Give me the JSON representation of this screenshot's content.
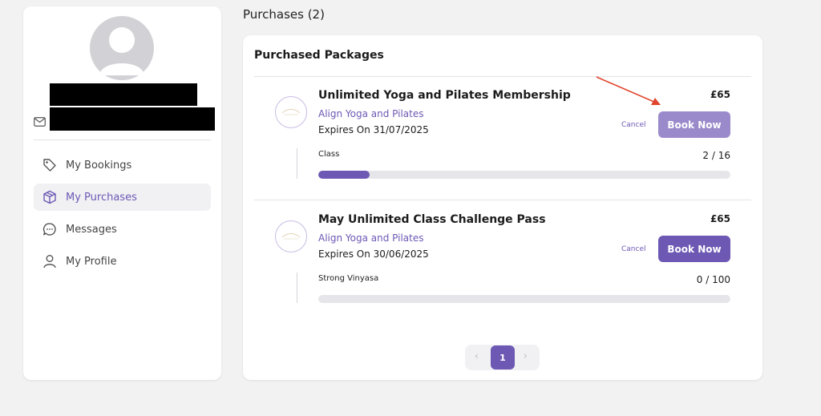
{
  "sidebar": {
    "nav": [
      {
        "label": "My Bookings",
        "icon": "tag-icon",
        "active": false
      },
      {
        "label": "My Purchases",
        "icon": "package-icon",
        "active": true
      },
      {
        "label": "Messages",
        "icon": "chat-bubble-icon",
        "active": false
      },
      {
        "label": "My Profile",
        "icon": "user-icon",
        "active": false
      }
    ]
  },
  "main": {
    "title": "Purchases (2)",
    "card_title": "Purchased Packages",
    "packages": [
      {
        "name": "Unlimited Yoga and Pilates Membership",
        "vendor": "Align Yoga and Pilates",
        "expiry": "Expires On 31/07/2025",
        "price": "£65",
        "cancel_label": "Cancel",
        "book_label": "Book Now",
        "class_label": "Class",
        "count": "2 / 16",
        "used": 2,
        "total": 16,
        "button_color": "#9b8acb"
      },
      {
        "name": "May Unlimited Class Challenge Pass",
        "vendor": "Align Yoga and Pilates",
        "expiry": "Expires On 30/06/2025",
        "price": "£65",
        "cancel_label": "Cancel",
        "book_label": "Book Now",
        "class_label": "Strong Vinyasa",
        "count": "0 / 100",
        "used": 0,
        "total": 100,
        "button_color": "#6d58b4"
      }
    ],
    "pagination": {
      "prev": "‹",
      "current": "1",
      "next": "›"
    }
  },
  "colors": {
    "accent": "#6d58b4",
    "annotation": "#e0452e"
  }
}
